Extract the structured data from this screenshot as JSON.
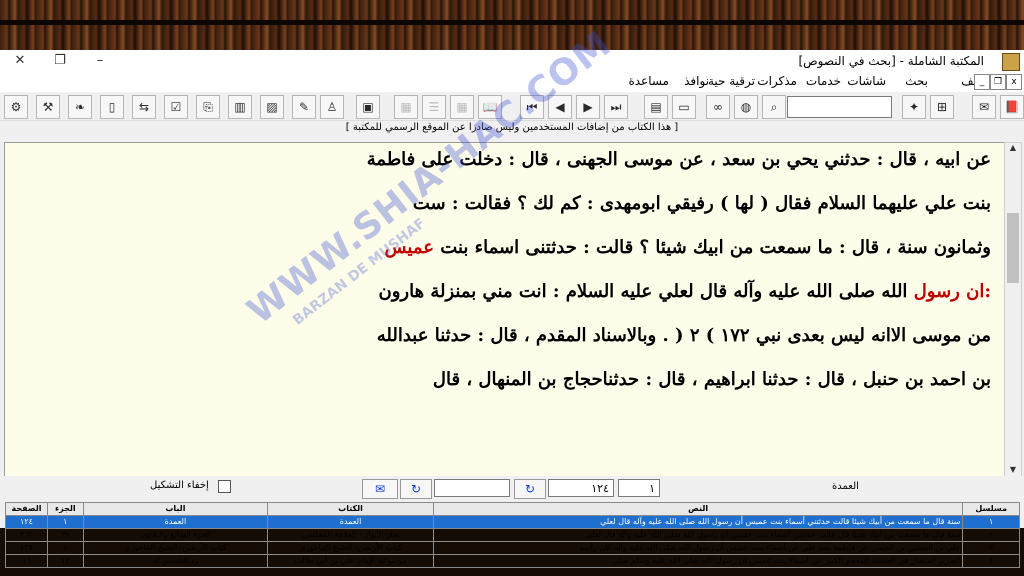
{
  "window": {
    "title": "المكتبة الشاملة - [بحث في النصوص]",
    "minimize": "–",
    "maximize": "❐",
    "close": "✕"
  },
  "menu": [
    "ملف",
    "بحث",
    "شاشات",
    "خدمات",
    "مذكرات",
    "ترقية حية",
    "نوافذ",
    "مساعدة"
  ],
  "notice": "[ هذا الكتاب من إضافات المستخدمين وليس صادرا عن الموقع الرسمي للمكتبة ]",
  "text_lines": [
    {
      "parts": [
        {
          "t": "عن ابيه ، قال : حدثني يحي بن سعد ، عن موسى الجهنى ، قال : دخلت على فاطمة",
          "red": false
        }
      ]
    },
    {
      "parts": [
        {
          "t": "بنت علي عليهما السلام فقال ( لها ) رفيقي ابومهدى : كم لك ؟ فقالت : ست",
          "red": false
        }
      ]
    },
    {
      "parts": [
        {
          "t": "وثمانون سنة ، قال : ما سمعت من ابيك شيئا ؟ قالت : حدثتنى اسماء بنت ",
          "red": false
        },
        {
          "t": "عميس",
          "red": true
        }
      ]
    },
    {
      "parts": [
        {
          "t": ":ان رسول",
          "red": true
        },
        {
          "t": " الله صلى الله عليه وآله قال لعلي عليه السلام : انت مني بمنزلة هارون",
          "red": false
        }
      ]
    },
    {
      "parts": [
        {
          "t": "من موسى الاانه ليس بعدى نبي ١٧٢ ) ٢ ( . وبالاسناد المقدم ، قال : حدثنا عبدالله",
          "red": false
        }
      ]
    },
    {
      "parts": [
        {
          "t": "بن احمد بن حنبل ، قال : حدثنا ابراهيم ، قال : حدثناحجاج بن المنهال ، قال",
          "red": false
        }
      ]
    }
  ],
  "controls": {
    "hide_tashkeel": "إخفاء التشكيل",
    "page_field": "١",
    "number_field": "١٢٤",
    "search_field": "",
    "count_label": "العمدة",
    "go_symbol": "↻"
  },
  "watermark": {
    "main": "WWW.SHIA-HAC.COM",
    "sub": "BARZAN DE MUSHAF"
  },
  "table": {
    "headers": [
      "مسلسل",
      "النص",
      "الكتاب",
      "الباب",
      "الجزء",
      "الصفحة"
    ],
    "rows": [
      [
        "١",
        "سنة قال ما سمعت من أبيك شيئا قالت حدثتني أسماء بنت عميس أن رسول الله صلى الله عليه وآله قال لعلي",
        "العمدة",
        "العمدة",
        "١",
        "١٢٤"
      ],
      [
        "٢",
        "سنة قال ما سمعت من أبيك شيئا قال قالت حدثتني أسماء بنت عميس أن رسول الله صلى الله عليه وآله قال لعلي",
        "بحار الأنوار - العلامة المجلسي",
        "الجزء السابع والثلاثون",
        "٣٧",
        "٣٦٢"
      ],
      [
        "٣",
        "علي بن الحسين بن الحسن عن فاطمة بنت علي عن أسماء بنت عميس أن رسول الله صلى الله عليه وآله كان رأسه",
        "كتاب الأربعين- الشيخ الماحوزي",
        "كتاب الأربعين- الشيخ الماحوزي",
        "١",
        "٤٣٧"
      ],
      [
        "٤",
        "كصرير المنشار في الخشبة المعجم الكبير عن أسماء بنت عميس إن رسول الله صلى الله عليه وسلم صلى",
        "موسوعة الإمام علي بن أبي طالب",
        "رد الشمس له",
        "١٢",
        "١٦"
      ]
    ],
    "selected_row": 0
  }
}
